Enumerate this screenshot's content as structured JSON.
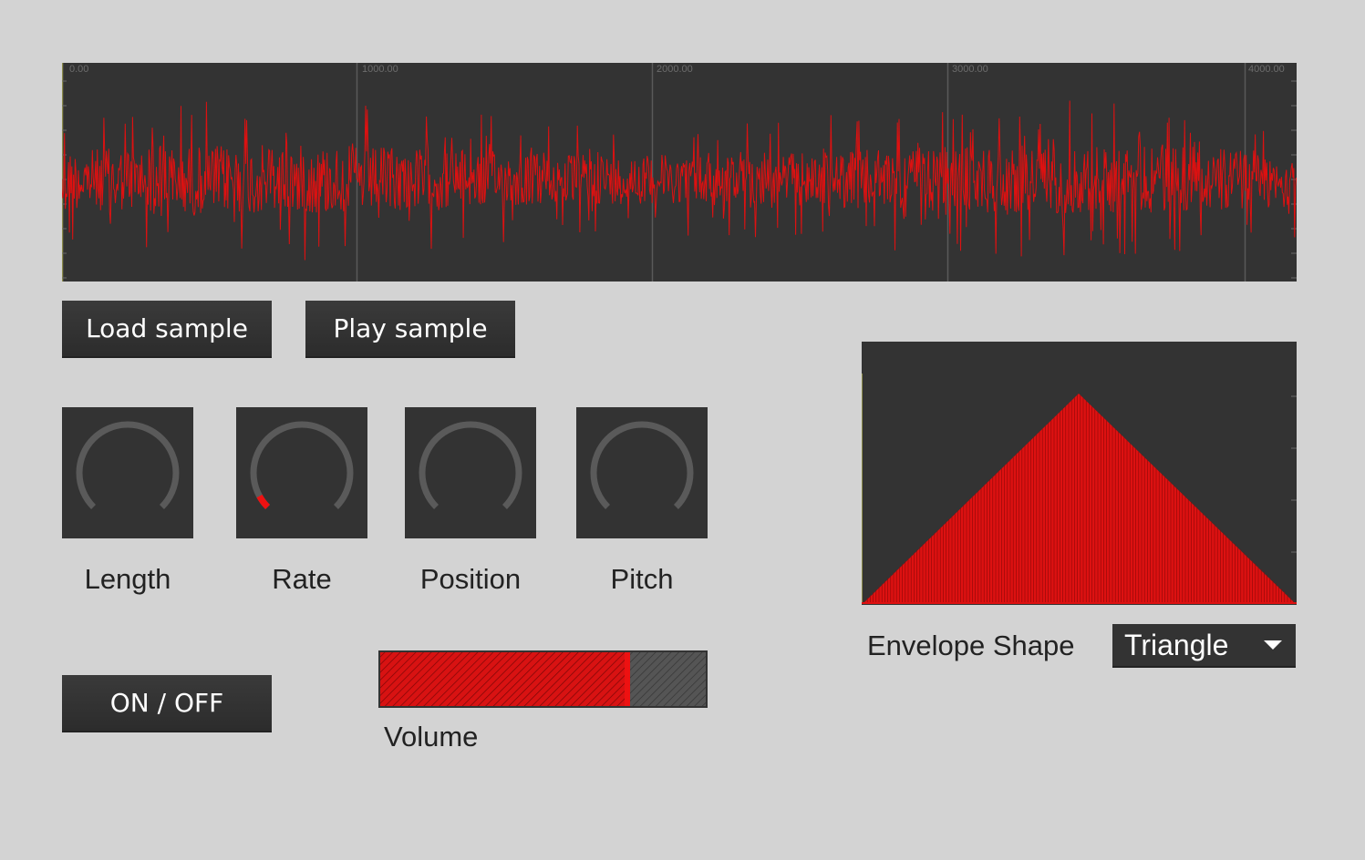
{
  "waveform": {
    "x_ticks": [
      "0.00",
      "1000.00",
      "2000.00",
      "3000.00",
      "4000.00"
    ],
    "x_range": [
      0,
      4000
    ],
    "color": "#dd1111",
    "background": "#333333"
  },
  "buttons": {
    "load": "Load sample",
    "play": "Play sample",
    "onoff": "ON / OFF"
  },
  "knobs": [
    {
      "label": "Length",
      "value": 0.0
    },
    {
      "label": "Rate",
      "value": 0.06
    },
    {
      "label": "Position",
      "value": 0.0
    },
    {
      "label": "Pitch",
      "value": 0.0
    }
  ],
  "volume": {
    "label": "Volume",
    "value": 0.76
  },
  "envelope": {
    "label": "Envelope Shape",
    "selected": "Triangle",
    "shape": "triangle",
    "color": "#dd1111"
  }
}
